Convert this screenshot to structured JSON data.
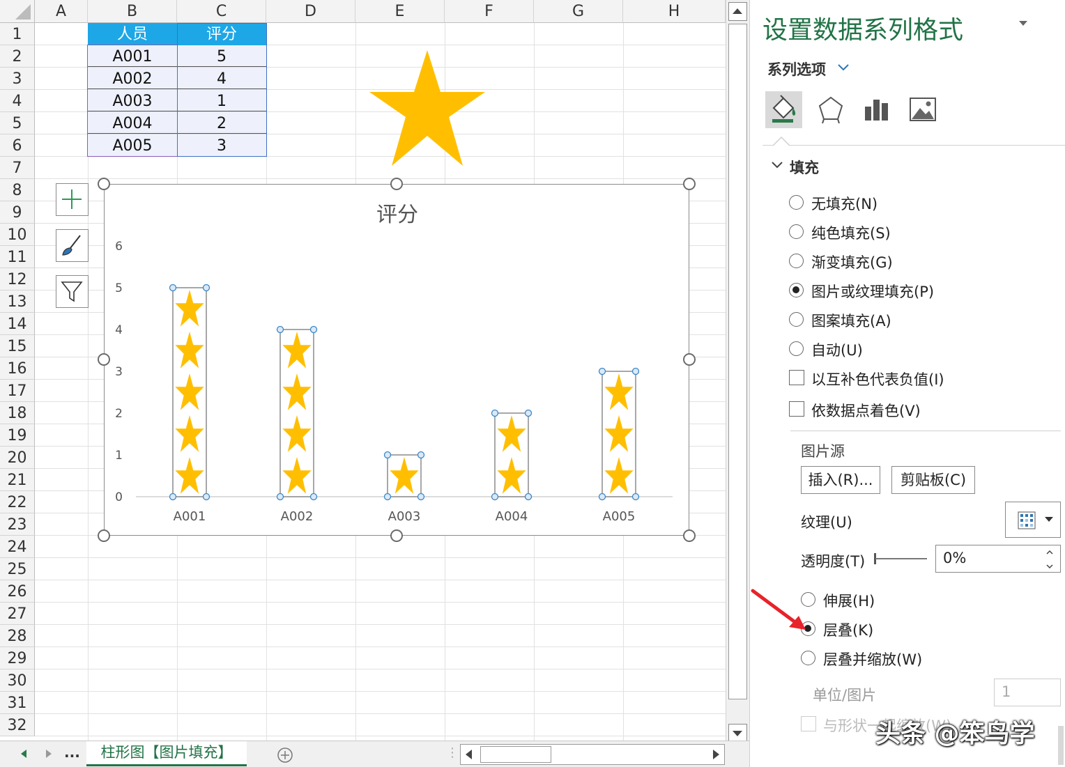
{
  "columns": [
    "A",
    "B",
    "C",
    "D",
    "E",
    "F",
    "G",
    "H"
  ],
  "rows": [
    "1",
    "2",
    "3",
    "4",
    "5",
    "6",
    "7",
    "8",
    "9",
    "10",
    "11",
    "12",
    "13",
    "14",
    "15",
    "16",
    "17",
    "18",
    "19",
    "20",
    "21",
    "22",
    "23",
    "24",
    "25",
    "26",
    "27",
    "28",
    "29",
    "30",
    "31",
    "32"
  ],
  "table": {
    "headers": [
      "人员",
      "评分"
    ],
    "rows": [
      [
        "A001",
        "5"
      ],
      [
        "A002",
        "4"
      ],
      [
        "A003",
        "1"
      ],
      [
        "A004",
        "2"
      ],
      [
        "A005",
        "3"
      ]
    ]
  },
  "chart_data": {
    "type": "bar",
    "title": "评分",
    "categories": [
      "A001",
      "A002",
      "A003",
      "A004",
      "A005"
    ],
    "values": [
      5,
      4,
      1,
      2,
      3
    ],
    "ylim": [
      0,
      6
    ],
    "yticks": [
      "0",
      "1",
      "2",
      "3",
      "4",
      "5",
      "6"
    ],
    "fill": "star picture, stacked",
    "star_color": "#ffbf00"
  },
  "sheet": {
    "tab": "柱形图【图片填充】",
    "more": "..."
  },
  "pane": {
    "title": "设置数据系列格式",
    "series_options": "系列选项",
    "section": "填充",
    "fill_options": [
      {
        "label": "无填充(N)",
        "checked": false
      },
      {
        "label": "纯色填充(S)",
        "checked": false
      },
      {
        "label": "渐变填充(G)",
        "checked": false
      },
      {
        "label": "图片或纹理填充(P)",
        "checked": true
      },
      {
        "label": "图案填充(A)",
        "checked": false
      },
      {
        "label": "自动(U)",
        "checked": false
      }
    ],
    "checkboxes": [
      {
        "label": "以互补色代表负值(I)"
      },
      {
        "label": "依数据点着色(V)"
      }
    ],
    "picture_source": "图片源",
    "insert_btn": "插入(R)...",
    "clipboard_btn": "剪贴板(C)",
    "texture": "纹理(U)",
    "transparency": "透明度(T)",
    "transparency_value": "0%",
    "stretch_options": [
      {
        "label": "伸展(H)",
        "checked": false
      },
      {
        "label": "层叠(K)",
        "checked": true
      },
      {
        "label": "层叠并缩放(W)",
        "checked": false
      }
    ],
    "unit_label": "单位/图片",
    "unit_value": "1",
    "scale_with_shape": "与形状一起缩放(W)"
  },
  "watermark": "头条 @笨鸟学",
  "colors": {
    "accent": "#217346",
    "header_blue": "#1ea7e6",
    "star": "#ffbf00",
    "arrow": "#e8222a"
  }
}
